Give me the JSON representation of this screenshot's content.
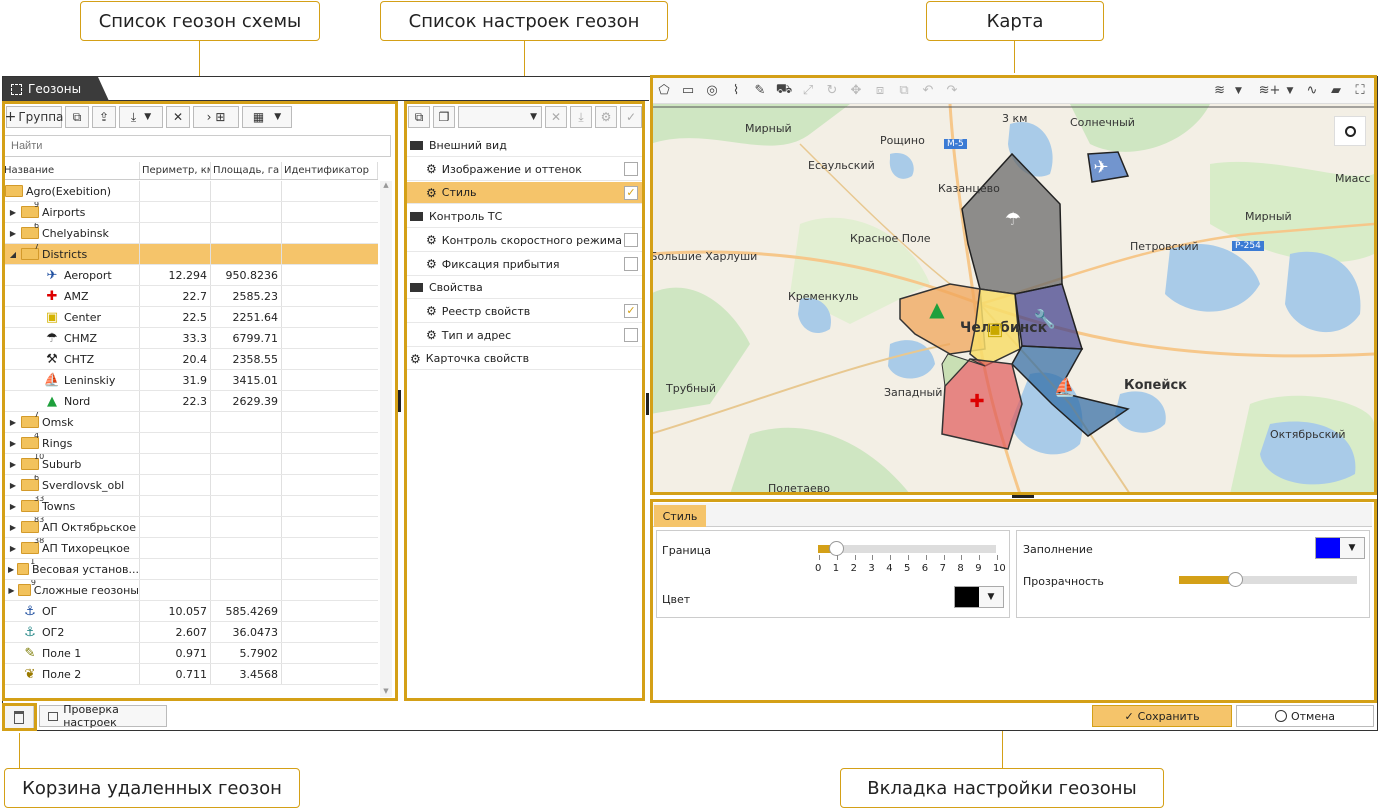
{
  "callouts": {
    "list": "Список геозон схемы",
    "settings": "Список настроек геозон",
    "map": "Карта",
    "trash": "Корзина удаленных геозон",
    "tab": "Вкладка настройки геозоны"
  },
  "window": {
    "title": "Геозоны"
  },
  "left_toolbar": {
    "group_label": "Группа"
  },
  "search": {
    "placeholder": "Найти"
  },
  "grid": {
    "columns": [
      "Название",
      "Периметр, км",
      "Площадь, га",
      "Идентификатор"
    ],
    "rows": [
      {
        "name": "Agro(Exebition)",
        "kind": "folder",
        "count": "",
        "perimeter": "",
        "area": "",
        "expanded": true,
        "indent": 0,
        "tri": ""
      },
      {
        "name": "Airports",
        "kind": "folder",
        "count": "9",
        "perimeter": "",
        "area": "",
        "indent": 1,
        "tri": "▶"
      },
      {
        "name": "Chelyabinsk",
        "kind": "folder",
        "count": "6",
        "perimeter": "",
        "area": "",
        "indent": 1,
        "tri": "▶"
      },
      {
        "name": "Districts",
        "kind": "folder",
        "count": "7",
        "perimeter": "",
        "area": "",
        "indent": 1,
        "tri": "◢",
        "selected": true
      },
      {
        "name": "Aeroport",
        "kind": "plane",
        "perimeter": "12.294",
        "area": "950.8236",
        "indent": 2
      },
      {
        "name": "AMZ",
        "kind": "medkit",
        "perimeter": "22.7",
        "area": "2585.23",
        "indent": 2
      },
      {
        "name": "Center",
        "kind": "bag",
        "perimeter": "22.5",
        "area": "2251.64",
        "indent": 2
      },
      {
        "name": "CHMZ",
        "kind": "umbrella",
        "perimeter": "33.3",
        "area": "6799.71",
        "indent": 2
      },
      {
        "name": "CHTZ",
        "kind": "wrench",
        "perimeter": "20.4",
        "area": "2358.55",
        "indent": 2
      },
      {
        "name": "Leninskiy",
        "kind": "boat",
        "perimeter": "31.9",
        "area": "3415.01",
        "indent": 2
      },
      {
        "name": "Nord",
        "kind": "tent",
        "perimeter": "22.3",
        "area": "2629.39",
        "indent": 2
      },
      {
        "name": "Omsk",
        "kind": "folder",
        "count": "7",
        "perimeter": "",
        "area": "",
        "indent": 1,
        "tri": "▶"
      },
      {
        "name": "Rings",
        "kind": "folder",
        "count": "4",
        "perimeter": "",
        "area": "",
        "indent": 1,
        "tri": "▶"
      },
      {
        "name": "Suburb",
        "kind": "folder",
        "count": "10",
        "perimeter": "",
        "area": "",
        "indent": 1,
        "tri": "▶"
      },
      {
        "name": "Sverdlovsk_obl",
        "kind": "folder",
        "count": "6",
        "perimeter": "",
        "area": "",
        "indent": 1,
        "tri": "▶"
      },
      {
        "name": "Towns",
        "kind": "folder",
        "count": "33",
        "perimeter": "",
        "area": "",
        "indent": 1,
        "tri": "▶"
      },
      {
        "name": "АП Октябрьское",
        "kind": "folder",
        "count": "83",
        "perimeter": "",
        "area": "",
        "indent": 1,
        "tri": "▶"
      },
      {
        "name": "АП Тихорецкое",
        "kind": "folder",
        "count": "38",
        "perimeter": "",
        "area": "",
        "indent": 1,
        "tri": "▶"
      },
      {
        "name": "Весовая установ...",
        "kind": "folder",
        "count": "1",
        "perimeter": "",
        "area": "",
        "indent": 1,
        "tri": "▶"
      },
      {
        "name": "Сложные геозоны",
        "kind": "folder",
        "count": "9",
        "perimeter": "",
        "area": "",
        "indent": 1,
        "tri": "▶"
      },
      {
        "name": "ОГ",
        "kind": "anchor",
        "perimeter": "10.057",
        "area": "585.4269",
        "indent": 1
      },
      {
        "name": "ОГ2",
        "kind": "anchor2",
        "perimeter": "2.607",
        "area": "36.0473",
        "indent": 1
      },
      {
        "name": "Поле 1",
        "kind": "pencil",
        "perimeter": "0.971",
        "area": "5.7902",
        "indent": 1
      },
      {
        "name": "Поле 2",
        "kind": "sprout",
        "perimeter": "0.711",
        "area": "3.4568",
        "indent": 1
      }
    ]
  },
  "bottom_left": {
    "check_settings": "Проверка настроек"
  },
  "settings_list": [
    {
      "label": "Внешний вид",
      "type": "folder",
      "checked": null
    },
    {
      "label": "Изображение и оттенок",
      "type": "item",
      "checked": false
    },
    {
      "label": "Стиль",
      "type": "item",
      "checked": true,
      "selected": true
    },
    {
      "label": "Контроль ТС",
      "type": "folder",
      "checked": null
    },
    {
      "label": "Контроль скоростного режима",
      "type": "item",
      "checked": false
    },
    {
      "label": "Фиксация прибытия",
      "type": "item",
      "checked": false
    },
    {
      "label": "Свойства",
      "type": "folder",
      "checked": null
    },
    {
      "label": "Реестр свойств",
      "type": "item",
      "checked": true
    },
    {
      "label": "Тип и адрес",
      "type": "item",
      "checked": false
    },
    {
      "label": "Карточка свойств",
      "type": "root",
      "checked": null
    }
  ],
  "map": {
    "scale": "3 км",
    "labels": [
      "Мирный",
      "Рощино",
      "Солнечный",
      "Есаульский",
      "Казанцево",
      "Миасс",
      "Красное Поле",
      "Мирный",
      "Петровский",
      "Большие Харлуши",
      "Кременкуль",
      "Трубный",
      "Западный",
      "Копейск",
      "Октябрьский",
      "Полетаево"
    ],
    "roads": [
      "М-5",
      "Р-254"
    ],
    "city": "Челябинск"
  },
  "style_tab": {
    "tab_label": "Стиль",
    "border_label": "Граница",
    "border_value": 1,
    "border_ticks": [
      "0",
      "1",
      "2",
      "3",
      "4",
      "5",
      "6",
      "7",
      "8",
      "9",
      "10"
    ],
    "color_label": "Цвет",
    "color_value": "#000000",
    "fill_label": "Заполнение",
    "fill_value": "#0000ff",
    "opacity_label": "Прозрачность",
    "opacity_value": 0.3
  },
  "actions": {
    "save": "Сохранить",
    "cancel": "Отмена"
  },
  "colors": {
    "accent": "#d4a017",
    "selected": "#f5c46a"
  }
}
